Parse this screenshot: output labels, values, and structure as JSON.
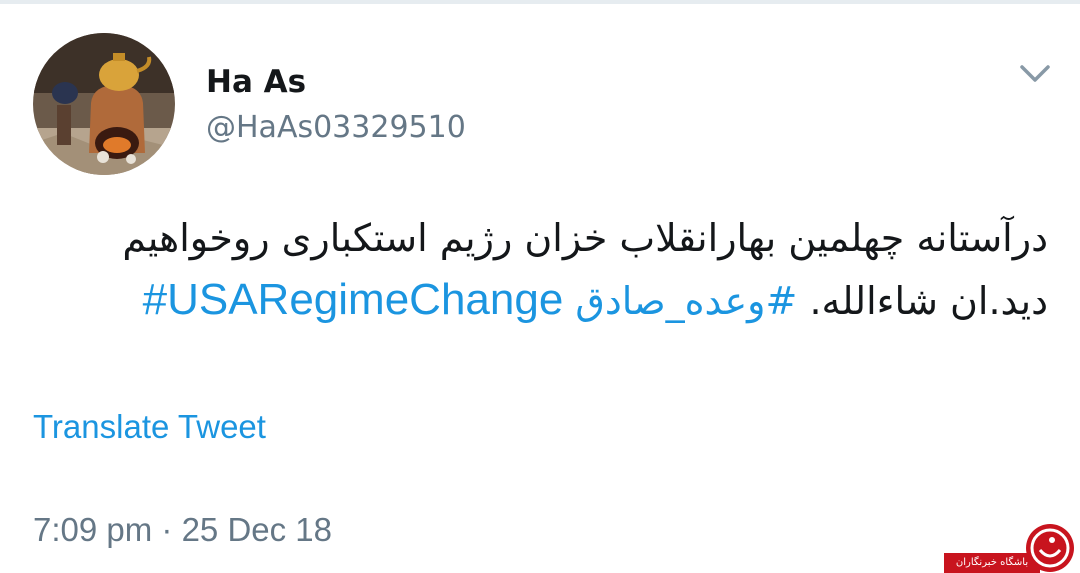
{
  "user": {
    "display_name": "Ha As",
    "handle": "@HaAs03329510",
    "avatar": "avatar-image"
  },
  "tweet": {
    "text_line_1": "درآستانه چهلمین بهارانقلاب خزان رژیم استکباری روخواهیم",
    "text_line_2_plain": "دید.ان شاءالله.",
    "hashtag_1": "#وعده_صادق",
    "hashtag_2": "#USARegimeChange"
  },
  "actions": {
    "translate_label": "Translate Tweet",
    "more_icon": "chevron-down-icon"
  },
  "meta": {
    "timestamp": "7:09 pm · 25 Dec 18"
  },
  "watermark": {
    "text": "باشگاه خبرنگاران"
  },
  "colors": {
    "link": "#1b95e0",
    "secondary_text": "#657786",
    "primary_text": "#14171a",
    "watermark_red": "#c8141e"
  }
}
